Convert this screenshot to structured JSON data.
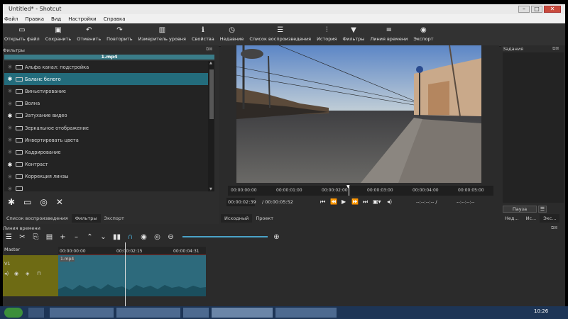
{
  "window": {
    "title": "Untitled* - Shotcut"
  },
  "menu": [
    "Файл",
    "Правка",
    "Вид",
    "Настройки",
    "Справка"
  ],
  "toolbar": [
    {
      "label": "Открыть файл",
      "icon": "folder-open-icon"
    },
    {
      "label": "Сохранить",
      "icon": "save-icon"
    },
    {
      "label": "Отменить",
      "icon": "undo-icon"
    },
    {
      "label": "Повторить",
      "icon": "redo-icon"
    },
    {
      "label": "Измеритель уровня",
      "icon": "level-meter-icon"
    },
    {
      "label": "Свойства",
      "icon": "info-icon"
    },
    {
      "label": "Недавние",
      "icon": "clock-icon"
    },
    {
      "label": "Список воспроизведения",
      "icon": "list-icon"
    },
    {
      "label": "История",
      "icon": "history-icon"
    },
    {
      "label": "Фильтры",
      "icon": "filter-icon"
    },
    {
      "label": "Линия времени",
      "icon": "timeline-icon"
    },
    {
      "label": "Экспорт",
      "icon": "export-icon"
    }
  ],
  "filters": {
    "title": "Фильтры",
    "file": "1.mp4",
    "items": [
      {
        "label": "Альфа канал: подстройка",
        "starred": false,
        "selected": false
      },
      {
        "label": "Баланс белого",
        "starred": true,
        "selected": true
      },
      {
        "label": "Виньетирование",
        "starred": false,
        "selected": false
      },
      {
        "label": "Волна",
        "starred": false,
        "selected": false
      },
      {
        "label": "Затухание видео",
        "starred": true,
        "selected": false
      },
      {
        "label": "Зеркальное отображение",
        "starred": false,
        "selected": false
      },
      {
        "label": "Инвертировать цвета",
        "starred": false,
        "selected": false
      },
      {
        "label": "Кадрирование",
        "starred": false,
        "selected": false
      },
      {
        "label": "Контраст",
        "starred": true,
        "selected": false
      },
      {
        "label": "Коррекция линзы",
        "starred": false,
        "selected": false
      },
      {
        "label": "",
        "starred": false,
        "selected": false
      }
    ],
    "tabs": [
      "Список воспроизведения",
      "Фильтры",
      "Экспорт"
    ]
  },
  "player": {
    "ruler_ticks": [
      "00:00:00:00",
      "00:00:01:00",
      "00:00:02:00",
      "00:00:03:00",
      "00:00:04:00",
      "00:00:05:00"
    ],
    "position": "00:00:02:39",
    "duration": "/ 00:00:05:52",
    "in_point": "--:--:--:-- /",
    "out_point": "--:--:--:--",
    "tabs": [
      "Исходный",
      "Проект"
    ]
  },
  "jobs": {
    "title": "Задания",
    "pause_label": "Пауза",
    "menu_label": "☰",
    "tabs": [
      "Нед...",
      "Ис...",
      "Экс..."
    ]
  },
  "timeline": {
    "title": "Линия времени",
    "master_label": "Master",
    "track_label": "V1",
    "clip_label": "1.mp4",
    "ticks": [
      "00:00:00:00",
      "00:00:02:15",
      "00:00:04:31"
    ]
  },
  "taskbar": {
    "clock": "10:26"
  },
  "colors": {
    "accent": "#236c7c",
    "clip": "#2d6a7c",
    "track": "#6e6b14"
  }
}
